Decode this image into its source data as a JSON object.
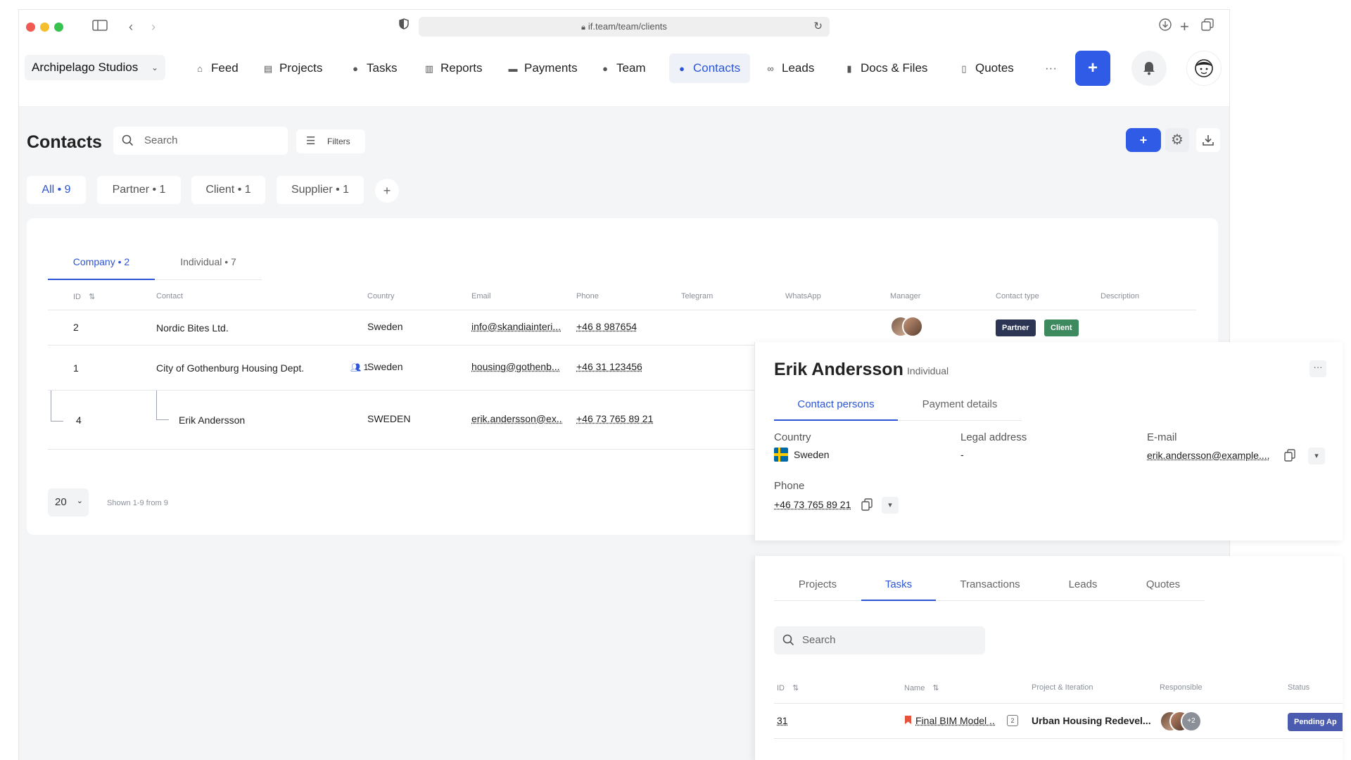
{
  "browser": {
    "url": "if.team/team/clients"
  },
  "nav": {
    "workspace": "Archipelago Studios",
    "items": [
      {
        "label": "Feed",
        "icon": "home-icon"
      },
      {
        "label": "Projects",
        "icon": "document-icon"
      },
      {
        "label": "Tasks",
        "icon": "check-circle-icon"
      },
      {
        "label": "Reports",
        "icon": "report-icon"
      },
      {
        "label": "Payments",
        "icon": "card-icon"
      },
      {
        "label": "Team",
        "icon": "user-icon"
      },
      {
        "label": "Contacts",
        "icon": "users-icon"
      },
      {
        "label": "Leads",
        "icon": "link-icon"
      },
      {
        "label": "Docs & Files",
        "icon": "books-icon"
      },
      {
        "label": "Quotes",
        "icon": "file-icon"
      }
    ],
    "more": "···",
    "add_label": "+"
  },
  "page": {
    "title": "Contacts",
    "search_placeholder": "Search",
    "filters_label": "Filters",
    "add_label": "+"
  },
  "chips": [
    {
      "label": "All • 9"
    },
    {
      "label": "Partner • 1"
    },
    {
      "label": "Client • 1"
    },
    {
      "label": "Supplier • 1"
    }
  ],
  "chip_add": "+",
  "subtabs": [
    {
      "label": "Company • 2"
    },
    {
      "label": "Individual • 7"
    }
  ],
  "table": {
    "columns": [
      "ID",
      "Contact",
      "Country",
      "Email",
      "Phone",
      "Telegram",
      "WhatsApp",
      "Manager",
      "Contact type",
      "Description"
    ],
    "sort_glyph": "⇅",
    "rows": [
      {
        "id": "2",
        "contact": "Nordic Bites Ltd.",
        "country": "Sweden",
        "email": "info@skandiainteri...",
        "phone": "+46 8 987654",
        "badges": [
          "Partner",
          "Client"
        ]
      },
      {
        "id": "1",
        "contact": "City of Gothenburg Housing Dept.",
        "persons": "1",
        "country": "Sweden",
        "email": "housing@gothenb...",
        "phone": "+46 31 123456"
      },
      {
        "id": "4",
        "contact": "Erik Andersson",
        "country": "SWEDEN",
        "email": "erik.andersson@ex...",
        "phone": "+46 73 765 89 21"
      }
    ]
  },
  "pager": {
    "size": "20",
    "shown": "Shown 1-9 from 9"
  },
  "detail": {
    "name": "Erik Andersson",
    "kind": "Individual",
    "more": "···",
    "tabs": [
      "Contact persons",
      "Payment details"
    ],
    "country_label": "Country",
    "country_value": "Sweden",
    "legal_label": "Legal address",
    "legal_value": "-",
    "email_label": "E-mail",
    "email_value": "erik.andersson@example....",
    "phone_label": "Phone",
    "phone_value": "+46 73 765 89 21",
    "bottom_tabs": [
      "Projects",
      "Tasks",
      "Transactions",
      "Leads",
      "Quotes"
    ],
    "search_placeholder": "Search",
    "task_columns": [
      "ID",
      "Name",
      "Project & Iteration",
      "Responsible",
      "Status"
    ],
    "task": {
      "id": "31",
      "name": "Final BIM Model ...",
      "count": "2",
      "project": "Urban Housing Redevel...",
      "more_people": "+2",
      "status": "Pending Ap"
    }
  },
  "colors": {
    "accent": "#2f5be7",
    "partner": "#2c3553",
    "client": "#3c8a5e",
    "status": "#4a5bb0"
  }
}
